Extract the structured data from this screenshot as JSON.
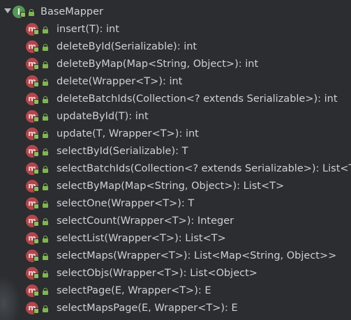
{
  "tree": {
    "root": {
      "label": "BaseMapper",
      "icon": "interface-icon",
      "icon_letter": "I",
      "expanded": true
    },
    "method_icon_letter": "m",
    "methods": [
      {
        "label": "insert(T): int"
      },
      {
        "label": "deleteById(Serializable): int"
      },
      {
        "label": "deleteByMap(Map<String, Object>): int"
      },
      {
        "label": "delete(Wrapper<T>): int"
      },
      {
        "label": "deleteBatchIds(Collection<? extends Serializable>): int"
      },
      {
        "label": "updateById(T): int"
      },
      {
        "label": "update(T, Wrapper<T>): int"
      },
      {
        "label": "selectById(Serializable): T"
      },
      {
        "label": "selectBatchIds(Collection<? extends Serializable>): List<T>"
      },
      {
        "label": "selectByMap(Map<String, Object>): List<T>"
      },
      {
        "label": "selectOne(Wrapper<T>): T"
      },
      {
        "label": "selectCount(Wrapper<T>): Integer"
      },
      {
        "label": "selectList(Wrapper<T>): List<T>"
      },
      {
        "label": "selectMaps(Wrapper<T>): List<Map<String, Object>>"
      },
      {
        "label": "selectObjs(Wrapper<T>): List<Object>"
      },
      {
        "label": "selectPage(E, Wrapper<T>): E"
      },
      {
        "label": "selectMapsPage(E, Wrapper<T>): E"
      }
    ]
  },
  "colors": {
    "background": "#2b2d30",
    "text": "#cdd1d6",
    "interface_icon": "#4f9a54",
    "method_icon": "#b4464b",
    "lock": "#7fb84a"
  }
}
